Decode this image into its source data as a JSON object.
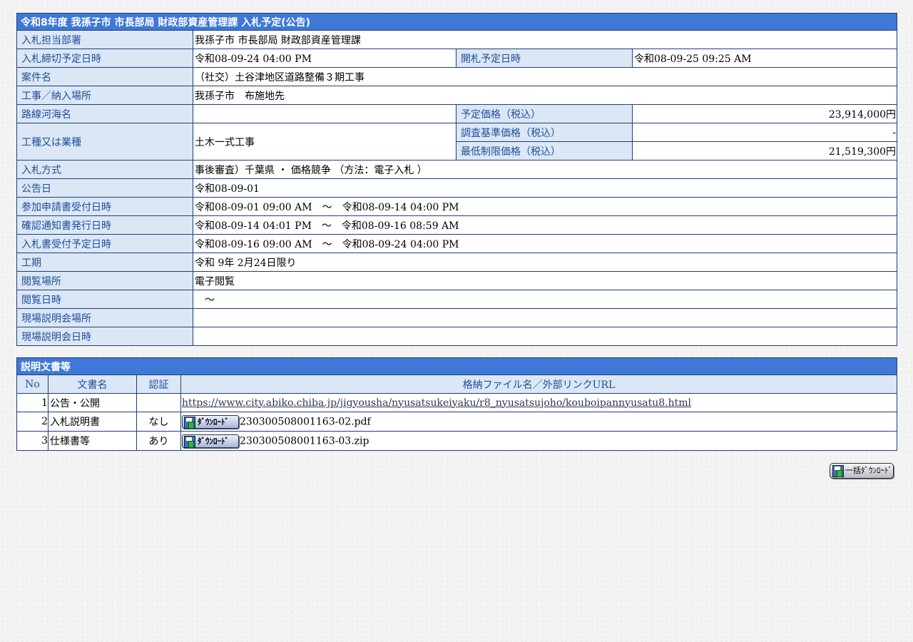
{
  "info": {
    "title": "令和8年度 我孫子市  市長部局  財政部資産管理課  入札予定(公告)",
    "rows": {
      "dept_label": "入札担当部署",
      "dept_value": "我孫子市  市長部局  財政部資産管理課",
      "deadline_label": "入札締切予定日時",
      "deadline_value": "令和08-09-24 04:00 PM",
      "opening_label": "開札予定日時",
      "opening_value": "令和08-09-25 09:25 AM",
      "project_label": "案件名",
      "project_value": "（社交）土谷津地区道路整備３期工事",
      "place_label": "工事／納入場所",
      "place_value": "我孫子市　布施地先",
      "route_label": "路線河海名",
      "route_value": "",
      "price_label": "予定価格（税込）",
      "price_value": "23,914,000円",
      "category_label": "工種又は業種",
      "category_value": "土木一式工事",
      "survey_label": "調査基準価格（税込）",
      "survey_value": "-",
      "minprice_label": "最低制限価格（税込）",
      "minprice_value": "21,519,300円",
      "method_label": "入札方式",
      "method_value": "事後審査）千葉県 ・ 価格競争 （方法：電子入札 ）",
      "notice_label": "公告日",
      "notice_value": "令和08-09-01",
      "apply_label": "参加申請書受付日時",
      "apply_value": "令和08-09-01 09:00 AM　～　令和08-09-14 04:00 PM",
      "confirm_label": "確認通知書発行日時",
      "confirm_value": "令和08-09-14 04:01 PM　～　令和08-09-16 08:59 AM",
      "receive_label": "入札書受付予定日時",
      "receive_value": "令和08-09-16 09:00 AM　～　令和08-09-24 04:00 PM",
      "period_label": "工期",
      "period_value": "令和 9年 2月24日限り",
      "viewplace_label": "閲覧場所",
      "viewplace_value": "電子閲覧",
      "viewdate_label": "閲覧日時",
      "viewdate_value": "　～",
      "siteplace_label": "現場説明会場所",
      "siteplace_value": "",
      "sitedate_label": "現場説明会日時",
      "sitedate_value": ""
    }
  },
  "docs": {
    "title": "説明文書等",
    "headers": [
      "No",
      "文書名",
      "認証",
      "格納ファイル名／外部リンクURL"
    ],
    "download_label": "ﾀﾞｳﾝﾛｰﾄﾞ",
    "rows": [
      {
        "no": "1",
        "name": "公告・公開",
        "auth": "",
        "link": "https://www.city.abiko.chiba.jp/jigyousha/nyusatsukeiyaku/r8_nyusatsujoho/kouboipannyusatu8.html"
      },
      {
        "no": "2",
        "name": "入札説明書",
        "auth": "なし",
        "file": "230300508001163-02.pdf"
      },
      {
        "no": "3",
        "name": "仕様書等",
        "auth": "あり",
        "file": "230300508001163-03.zip"
      }
    ]
  },
  "bulk_download_label": "一括ﾀﾞｳﾝﾛｰﾄﾞ"
}
